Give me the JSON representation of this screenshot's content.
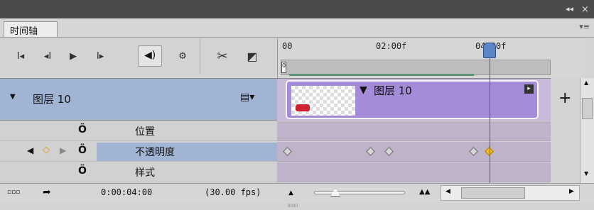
{
  "window": {
    "collapse": "◂◂",
    "close": "×"
  },
  "tab": {
    "label": "时间轴"
  },
  "transport": {
    "first": "I◂",
    "prev": "◂I",
    "play": "▶",
    "next": "I▸",
    "loop": "◈",
    "settings": "⚙",
    "scissors": "✂",
    "transition": "◩"
  },
  "ruler": {
    "ticks": [
      "00",
      "02:00f",
      "04:00f"
    ],
    "in_marker": "0"
  },
  "layer": {
    "name": "图层 10",
    "film_icon": "▤▾",
    "clip_title": "图层 10",
    "add": "+"
  },
  "properties": [
    {
      "label": "位置"
    },
    {
      "label": "不透明度",
      "selected": true
    },
    {
      "label": "样式"
    }
  ],
  "status": {
    "render_icon": "▫▫▫",
    "export_icon": "➦",
    "timecode": "0:00:04:00",
    "fps": "(30.00 fps)",
    "zoom_out": "▲",
    "zoom_in": "▲▲"
  },
  "colors": {
    "layer_bg": "#a2b4d4",
    "clip": "#a58cd8",
    "playhead": "#e02020",
    "keyframe_active": "#f0c020"
  }
}
